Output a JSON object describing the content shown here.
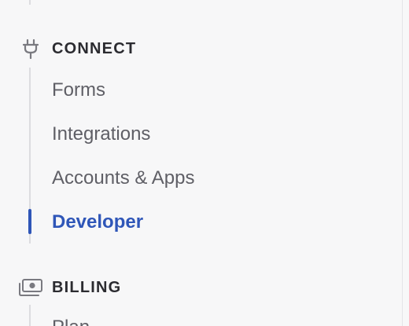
{
  "sidebar": {
    "sections": [
      {
        "title": "CONNECT",
        "icon": "plug-icon",
        "items": [
          {
            "label": "Forms",
            "active": false
          },
          {
            "label": "Integrations",
            "active": false
          },
          {
            "label": "Accounts & Apps",
            "active": false
          },
          {
            "label": "Developer",
            "active": true
          }
        ]
      },
      {
        "title": "BILLING",
        "icon": "money-icon",
        "items": [
          {
            "label": "Plan",
            "active": false
          }
        ]
      }
    ]
  },
  "colors": {
    "background": "#f7f7f8",
    "active": "#2f56b8",
    "text": "#5f5f66",
    "heading": "#2b2b30"
  }
}
